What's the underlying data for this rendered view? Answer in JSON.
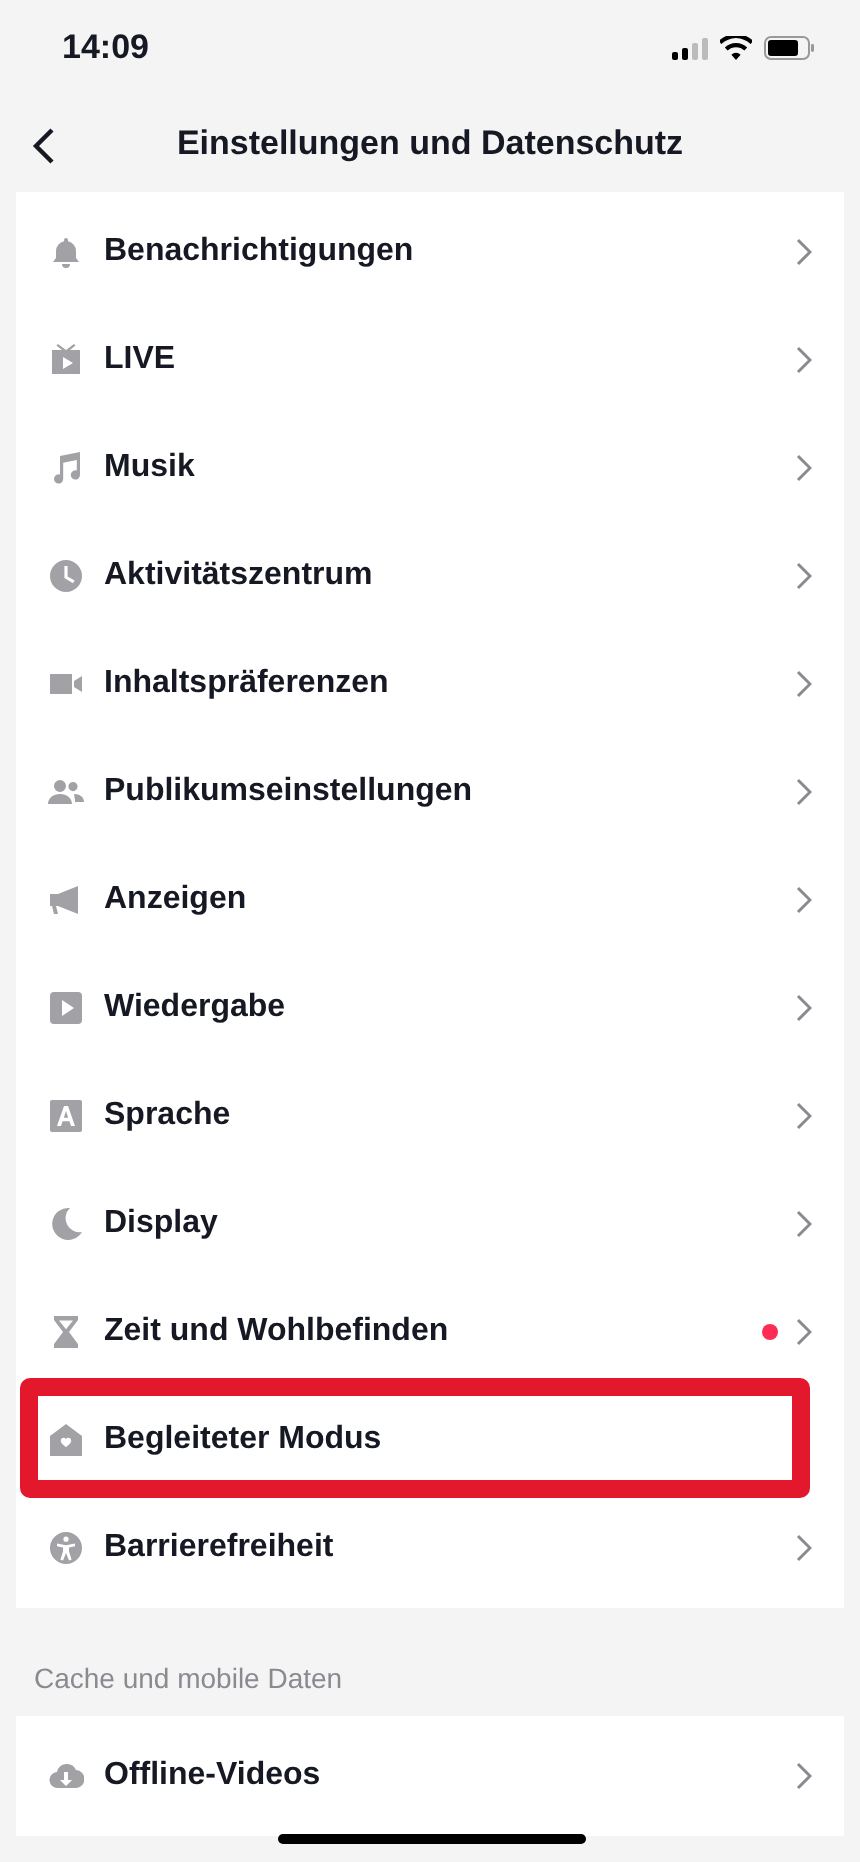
{
  "status_bar": {
    "time": "14:09"
  },
  "header": {
    "title": "Einstellungen und Datenschutz"
  },
  "sections": [
    {
      "items": [
        {
          "label": "Benachrichtigungen",
          "chevron": true,
          "dot": false,
          "highlighted": false
        },
        {
          "label": "LIVE",
          "chevron": true,
          "dot": false,
          "highlighted": false
        },
        {
          "label": "Musik",
          "chevron": true,
          "dot": false,
          "highlighted": false
        },
        {
          "label": "Aktivitätszentrum",
          "chevron": true,
          "dot": false,
          "highlighted": false
        },
        {
          "label": "Inhaltspräferenzen",
          "chevron": true,
          "dot": false,
          "highlighted": false
        },
        {
          "label": "Publikumseinstellungen",
          "chevron": true,
          "dot": false,
          "highlighted": false
        },
        {
          "label": "Anzeigen",
          "chevron": true,
          "dot": false,
          "highlighted": false
        },
        {
          "label": "Wiedergabe",
          "chevron": true,
          "dot": false,
          "highlighted": false
        },
        {
          "label": "Sprache",
          "chevron": true,
          "dot": false,
          "highlighted": false
        },
        {
          "label": "Display",
          "chevron": true,
          "dot": false,
          "highlighted": false
        },
        {
          "label": "Zeit und Wohlbefinden",
          "chevron": true,
          "dot": true,
          "highlighted": false
        },
        {
          "label": "Begleiteter Modus",
          "chevron": false,
          "dot": false,
          "highlighted": true
        },
        {
          "label": "Barrierefreiheit",
          "chevron": true,
          "dot": false,
          "highlighted": false
        }
      ]
    },
    {
      "heading": "Cache und mobile Daten",
      "items": [
        {
          "label": "Offline-Videos",
          "chevron": true,
          "dot": false,
          "highlighted": false
        }
      ]
    }
  ]
}
